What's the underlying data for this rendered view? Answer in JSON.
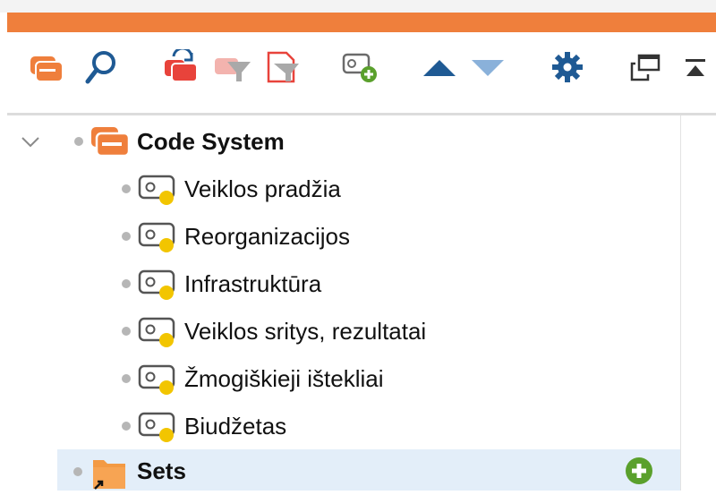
{
  "code_system": {
    "root_label": "Code System",
    "codes": [
      {
        "label": "Veiklos pradžia"
      },
      {
        "label": "Reorganizacijos"
      },
      {
        "label": "Infrastruktūra"
      },
      {
        "label": "Veiklos sritys, rezultatai"
      },
      {
        "label": "Žmogiškieji ištekliai"
      },
      {
        "label": "Biudžetas"
      }
    ],
    "sets_label": "Sets"
  },
  "colors": {
    "accent_orange": "#ef7f3c",
    "code_dot_yellow": "#f2c500",
    "selection": "#e3eef9",
    "add_green": "#5aa02c",
    "icon_blue": "#1f5a94"
  },
  "toolbar_icons": [
    "code-system-icon",
    "search-icon",
    "code-sets-reset-icon",
    "filter-icon",
    "filter-document-icon",
    "new-code-icon",
    "move-up-icon",
    "move-down-icon",
    "settings-gear-icon",
    "undock-window-icon",
    "collapse-top-icon"
  ]
}
